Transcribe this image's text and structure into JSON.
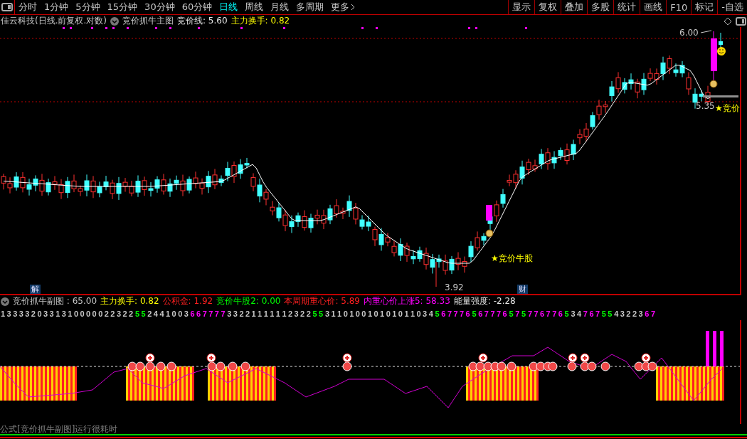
{
  "toolbar": {
    "periods": [
      {
        "label": "分时",
        "selected": false
      },
      {
        "label": "1分钟",
        "selected": false
      },
      {
        "label": "5分钟",
        "selected": false
      },
      {
        "label": "15分钟",
        "selected": false
      },
      {
        "label": "30分钟",
        "selected": false
      },
      {
        "label": "60分钟",
        "selected": false
      },
      {
        "label": "日线",
        "selected": true
      },
      {
        "label": "周线",
        "selected": false
      },
      {
        "label": "月线",
        "selected": false
      },
      {
        "label": "多周期",
        "selected": false
      },
      {
        "label": "更多",
        "selected": false
      }
    ],
    "buttons": [
      "显示",
      "复权",
      "叠加",
      "多股",
      "统计",
      "画线",
      "F10",
      "标记",
      "-自选"
    ]
  },
  "main_header": {
    "title": "佳云科技(日线.前复权.对数)",
    "indicator": "竞价抓牛主图",
    "fields": [
      {
        "text": "竞价线: 5.60",
        "color": "#e8e8e8"
      },
      {
        "text": "主力换手: 0.82",
        "color": "#ffff00"
      }
    ]
  },
  "main_chart": {
    "labels": [
      {
        "kind": "high",
        "text": "6.00"
      },
      {
        "kind": "low",
        "text": "3.92"
      },
      {
        "kind": "last",
        "text": "5.35"
      },
      {
        "kind": "signal",
        "text": "★竞价牛股"
      },
      {
        "kind": "signal_edge",
        "text": "★竞价"
      }
    ],
    "badges": [
      {
        "kind": "left",
        "text": "解"
      },
      {
        "kind": "right",
        "text": "财"
      }
    ]
  },
  "sub_header": {
    "title": "竞价抓牛副图 : 65.00",
    "fields": [
      {
        "text": "主力换手: 0.82",
        "color": "#ffff00"
      },
      {
        "text": "公积金: 1.92",
        "color": "#ff2020"
      },
      {
        "text": "竞价牛股2: 0.00",
        "color": "#00ff00"
      },
      {
        "text": "本周期重心价: 5.89",
        "color": "#ff2020"
      },
      {
        "text": "内重心价上涨5: 58.33",
        "color": "#ff00ff"
      },
      {
        "text": "能量强度: -2.28",
        "color": "#e8e8e8"
      }
    ]
  },
  "digits": [
    {
      "text": "1 3 3 3 3 2 0 3 3 1 3 1 0 0 0 0 0 2 2 3 2 2",
      "color": "#c8c8c8"
    },
    {
      "text": "5 5",
      "color": "#00ff00"
    },
    {
      "text": "2 4 4 1 0 0 3",
      "color": "#c8c8c8"
    },
    {
      "text": "6 6 7 7 7 7",
      "color": "#ff00ff"
    },
    {
      "text": "3 3 2 2 1 1 1 1 1 1 2 3 2 2",
      "color": "#c8c8c8"
    },
    {
      "text": "5 5",
      "color": "#00ff00"
    },
    {
      "text": "3 1 1 0 1 0 0 1 0 1 0 1 0 1 1 0 3 4",
      "color": "#c8c8c8"
    },
    {
      "text": "5",
      "color": "#00ff00"
    },
    {
      "text": "6 7 7 7 6",
      "color": "#ff00ff"
    },
    {
      "text": "5",
      "color": "#00ff00"
    },
    {
      "text": "6 7 7 7 6",
      "color": "#ff00ff"
    },
    {
      "text": "5",
      "color": "#00ff00"
    },
    {
      "text": "7",
      "color": "#ff00ff"
    },
    {
      "text": "5",
      "color": "#00ff00"
    },
    {
      "text": "7 7 6 7 7 6",
      "color": "#ff00ff"
    },
    {
      "text": "5",
      "color": "#00ff00"
    },
    {
      "text": "3 4",
      "color": "#c8c8c8"
    },
    {
      "text": "7 6 7",
      "color": "#ff00ff"
    },
    {
      "text": "5 5",
      "color": "#00ff00"
    },
    {
      "text": "4 3 2 2 3",
      "color": "#c8c8c8"
    },
    {
      "text": "6 7",
      "color": "#ff00ff"
    }
  ],
  "status_bar": "公式[竞价抓牛副图]运行很耗时"
}
